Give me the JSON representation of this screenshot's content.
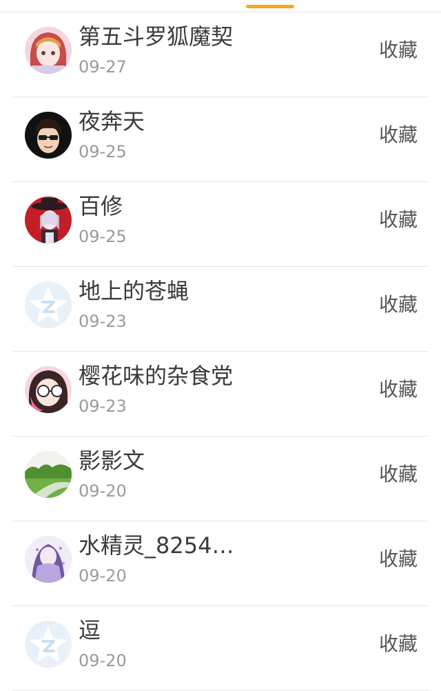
{
  "tab_indicator_color": "#f5a623",
  "action_label": "收藏",
  "items": [
    {
      "name": "第五斗罗狐魔契",
      "date": "09-27",
      "avatar": "anime-girl-avatar"
    },
    {
      "name": "夜奔天",
      "date": "09-25",
      "avatar": "sunglasses-boy-avatar"
    },
    {
      "name": "百修",
      "date": "09-25",
      "avatar": "red-hat-girl-avatar"
    },
    {
      "name": "地上的苍蝇",
      "date": "09-23",
      "avatar": "default-qq-avatar"
    },
    {
      "name": "樱花味的杂食党",
      "date": "09-23",
      "avatar": "glasses-girl-avatar"
    },
    {
      "name": "影影文",
      "date": "09-20",
      "avatar": "landscape-avatar"
    },
    {
      "name": "水精灵_8254…",
      "date": "09-20",
      "avatar": "purple-fairy-avatar"
    },
    {
      "name": "逗",
      "date": "09-20",
      "avatar": "default-qq-avatar"
    }
  ]
}
